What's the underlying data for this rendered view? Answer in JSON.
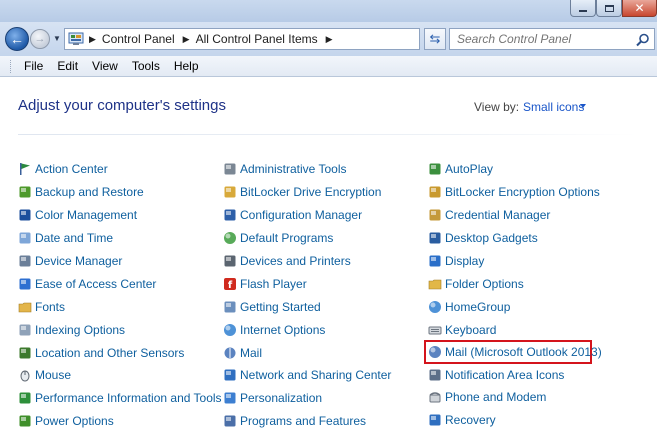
{
  "titlebar": {
    "min_glyph": "",
    "close_glyph": "✕"
  },
  "nav": {
    "back_glyph": "←",
    "forward_glyph": "→",
    "recent_glyph": "▼",
    "breadcrumbs": [
      "Control Panel",
      "All Control Panel Items"
    ],
    "sep_glyph": "▶",
    "refresh_glyph": "⇆",
    "search_placeholder": "Search Control Panel"
  },
  "menu": [
    "File",
    "Edit",
    "View",
    "Tools",
    "Help"
  ],
  "content": {
    "heading": "Adjust your computer's settings",
    "view_by_label": "View by:",
    "view_by_value": "Small icons"
  },
  "columns": [
    [
      {
        "label": "Action Center",
        "icon": "flag-icon",
        "color": "#2b8a3e"
      },
      {
        "label": "Backup and Restore",
        "icon": "backup-icon",
        "color": "#4e9a2b"
      },
      {
        "label": "Color Management",
        "icon": "monitor-icon",
        "color": "#1c4f9c"
      },
      {
        "label": "Date and Time",
        "icon": "calendar-clock-icon",
        "color": "#7ea6d8"
      },
      {
        "label": "Device Manager",
        "icon": "device-manager-icon",
        "color": "#6b7f99"
      },
      {
        "label": "Ease of Access Center",
        "icon": "ease-of-access-icon",
        "color": "#2e6fd1"
      },
      {
        "label": "Fonts",
        "icon": "fonts-folder-icon",
        "color": "#e3b54a"
      },
      {
        "label": "Indexing Options",
        "icon": "indexing-icon",
        "color": "#8fa2b8"
      },
      {
        "label": "Location and Other Sensors",
        "icon": "sensors-icon",
        "color": "#3d7a2e"
      },
      {
        "label": "Mouse",
        "icon": "mouse-icon",
        "color": "#5d6670"
      },
      {
        "label": "Performance Information and Tools",
        "icon": "performance-icon",
        "color": "#2d8f3a"
      },
      {
        "label": "Power Options",
        "icon": "power-icon",
        "color": "#3f8f2a"
      }
    ],
    [
      {
        "label": "Administrative Tools",
        "icon": "admin-tools-icon",
        "color": "#7b8794"
      },
      {
        "label": "BitLocker Drive Encryption",
        "icon": "bitlocker-icon",
        "color": "#d8a93a"
      },
      {
        "label": "Configuration Manager",
        "icon": "config-manager-icon",
        "color": "#2d5fa8"
      },
      {
        "label": "Default Programs",
        "icon": "default-programs-icon",
        "color": "#3b9b3c"
      },
      {
        "label": "Devices and Printers",
        "icon": "printer-icon",
        "color": "#5b6570"
      },
      {
        "label": "Flash Player",
        "icon": "flash-icon",
        "color": "#d02a1e"
      },
      {
        "label": "Getting Started",
        "icon": "getting-started-icon",
        "color": "#6b8fbd"
      },
      {
        "label": "Internet Options",
        "icon": "internet-options-icon",
        "color": "#2f7fd0"
      },
      {
        "label": "Mail",
        "icon": "mail-icon",
        "color": "#3e6db5"
      },
      {
        "label": "Network and Sharing Center",
        "icon": "network-icon",
        "color": "#2f6fc0"
      },
      {
        "label": "Personalization",
        "icon": "personalization-icon",
        "color": "#3d7fd1"
      },
      {
        "label": "Programs and Features",
        "icon": "programs-icon",
        "color": "#4b6fa8"
      }
    ],
    [
      {
        "label": "AutoPlay",
        "icon": "autoplay-icon",
        "color": "#3b8f3d"
      },
      {
        "label": "BitLocker Encryption Options",
        "icon": "bitlocker-options-icon",
        "color": "#c99a2f"
      },
      {
        "label": "Credential Manager",
        "icon": "credential-icon",
        "color": "#c49a3a"
      },
      {
        "label": "Desktop Gadgets",
        "icon": "gadgets-icon",
        "color": "#2a5da0"
      },
      {
        "label": "Display",
        "icon": "display-icon",
        "color": "#2a6fc9"
      },
      {
        "label": "Folder Options",
        "icon": "folder-options-icon",
        "color": "#e2b747"
      },
      {
        "label": "HomeGroup",
        "icon": "homegroup-icon",
        "color": "#2f7fd0"
      },
      {
        "label": "Keyboard",
        "icon": "keyboard-icon",
        "color": "#6d7580"
      },
      {
        "label": "Mail (Microsoft Outlook 2013)",
        "icon": "outlook-mail-icon",
        "color": "#3e6db5",
        "highlight": "#d4141c"
      },
      {
        "label": "Notification Area Icons",
        "icon": "notification-icon",
        "color": "#5c6f88"
      },
      {
        "label": "Phone and Modem",
        "icon": "phone-icon",
        "color": "#6b7480"
      },
      {
        "label": "Recovery",
        "icon": "recovery-icon",
        "color": "#2f6fc0"
      }
    ]
  ]
}
